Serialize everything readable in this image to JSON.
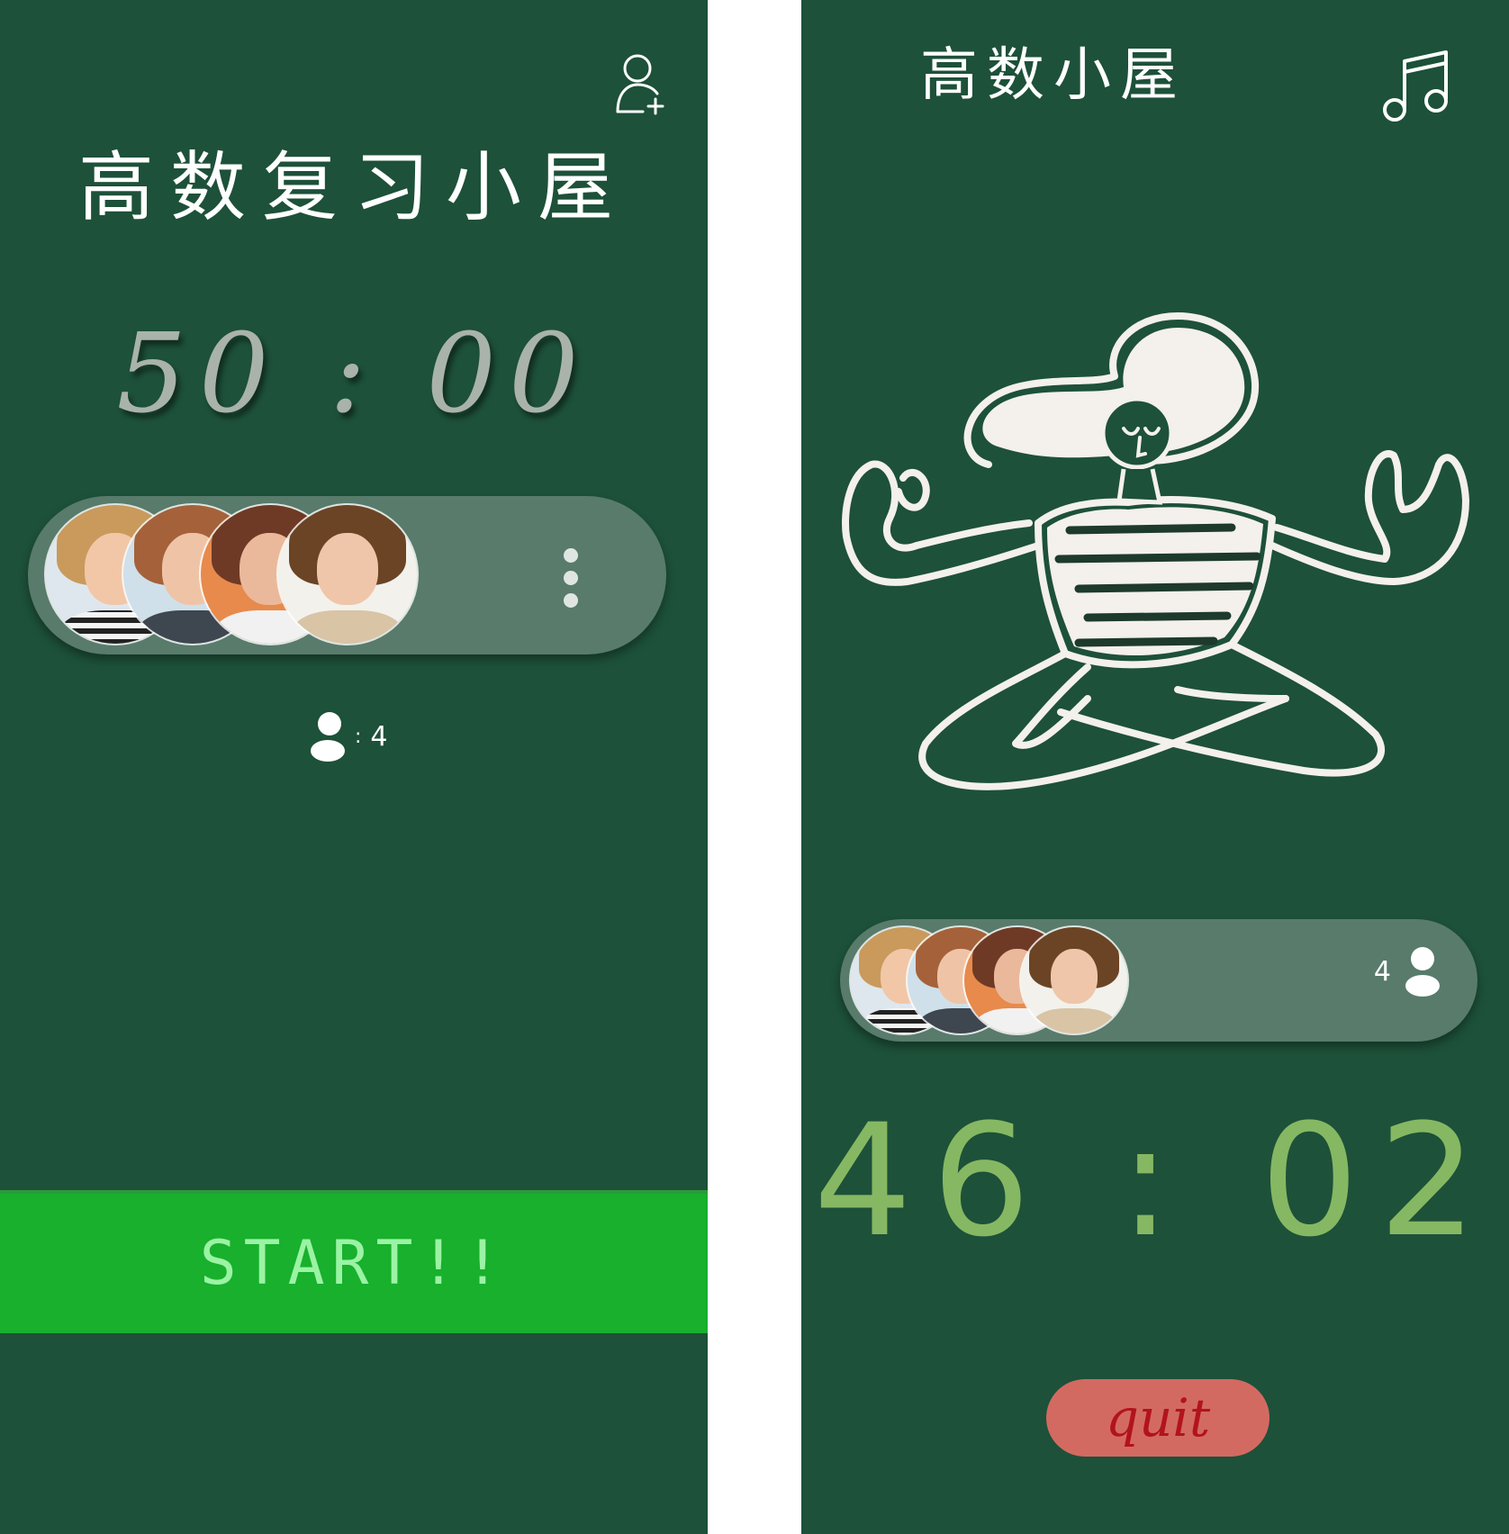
{
  "colors": {
    "background": "#1d5139",
    "panel": "#587b6b",
    "start_bar": "#18b02d",
    "start_text": "#9bf3a4",
    "timer_right": "#86b863",
    "quit_bg": "#d36a62",
    "quit_text": "#b2131e"
  },
  "left_screen": {
    "title": "高数复习小屋",
    "timer": "50 : 00",
    "member_count": "4",
    "count_separator": ":",
    "start_label": "START!!",
    "icons": [
      "add-user-icon",
      "more-vertical-icon",
      "person-icon"
    ]
  },
  "right_screen": {
    "title": "高数小屋",
    "timer": "46 : 02",
    "member_count": "4",
    "quit_label": "quit",
    "icons": [
      "music-note-icon",
      "person-icon",
      "meditation-illustration"
    ]
  }
}
